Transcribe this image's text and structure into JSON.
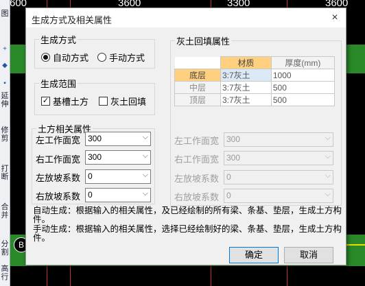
{
  "background": {
    "dimensions": [
      "600",
      "3600",
      "3300",
      "3600"
    ],
    "axis_label": "B",
    "toolbar_chars": [
      "图",
      "+",
      "◆",
      "▪",
      "延",
      "伸",
      "修",
      "剪",
      "打",
      "断",
      "合",
      "并",
      "分",
      "割",
      "高",
      "行"
    ]
  },
  "dialog": {
    "title": "生成方式及相关属性",
    "close_icon": "×",
    "gen_method": {
      "legend": "生成方式",
      "auto": "自动方式",
      "manual": "手动方式",
      "selected": "auto"
    },
    "gen_range": {
      "legend": "生成范围",
      "trench": "基槽土方",
      "trench_checked": true,
      "backfill": "灰土回填",
      "backfill_checked": false
    },
    "earth_props": {
      "legend": "土方相关属性",
      "rows": [
        {
          "label": "左工作面宽",
          "value": "300"
        },
        {
          "label": "右工作面宽",
          "value": "300"
        },
        {
          "label": "左放坡系数",
          "value": "0"
        },
        {
          "label": "右放坡系数",
          "value": "0"
        }
      ]
    },
    "backfill_props": {
      "legend": "灰土回填属性",
      "col_material": "材质",
      "col_thickness": "厚度(mm)",
      "rows": [
        {
          "name": "底层",
          "material": "3:7灰土",
          "thickness": "1000"
        },
        {
          "name": "中层",
          "material": "3:7灰土",
          "thickness": "500"
        },
        {
          "name": "顶层",
          "material": "3:7灰土",
          "thickness": "500"
        }
      ],
      "side_rows": [
        {
          "label": "左工作面宽",
          "value": "300"
        },
        {
          "label": "右工作面宽",
          "value": "300"
        },
        {
          "label": "左放坡系数",
          "value": "0"
        },
        {
          "label": "右放坡系数",
          "value": "0"
        }
      ]
    },
    "notes": {
      "auto": "自动生成：根据输入的相关属性，及已经绘制的所有梁、条基、垫层，生成土方构件。",
      "manual": "手动生成：根据输入的相关属性，选择已经绘制好的梁、条基、垫层，生成土方构件。"
    },
    "ok": "确定",
    "cancel": "取消"
  }
}
